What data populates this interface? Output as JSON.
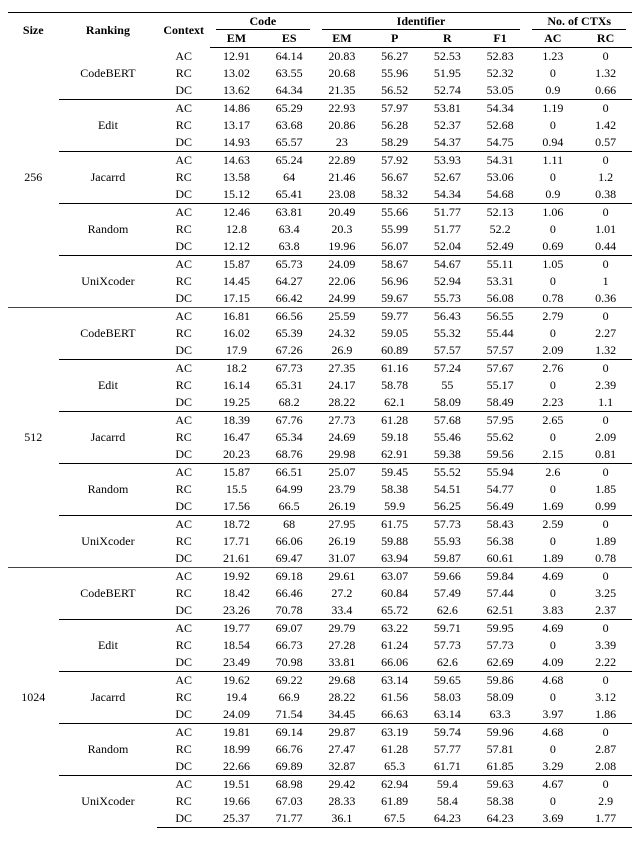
{
  "header": {
    "size": "Size",
    "ranking": "Ranking",
    "context": "Context",
    "code_group": "Code",
    "code_em": "EM",
    "code_es": "ES",
    "ident_group": "Identifier",
    "ident_em": "EM",
    "ident_p": "P",
    "ident_r": "R",
    "ident_f1": "F1",
    "nctx_group": "No. of CTXs",
    "nctx_ac": "AC",
    "nctx_rc": "RC"
  },
  "sizes": [
    "256",
    "512",
    "1024"
  ],
  "rankings": [
    "CodeBERT",
    "Edit",
    "Jacarrd",
    "Random",
    "UniXcoder"
  ],
  "contexts": [
    "AC",
    "RC",
    "DC"
  ],
  "chart_data": {
    "type": "table",
    "columns": [
      "Size",
      "Ranking",
      "Context",
      "Code.EM",
      "Code.ES",
      "Identifier.EM",
      "Identifier.P",
      "Identifier.R",
      "Identifier.F1",
      "CTXs.AC",
      "CTXs.RC"
    ]
  },
  "data": {
    "256": {
      "CodeBERT": {
        "AC": {
          "c_em": "12.91",
          "c_es": "64.14",
          "i_em": "20.83",
          "i_p": "56.27",
          "i_r": "52.53",
          "i_f1": "52.83",
          "n_ac": "1.23",
          "n_rc": "0"
        },
        "RC": {
          "c_em": "13.02",
          "c_es": "63.55",
          "i_em": "20.68",
          "i_p": "55.96",
          "i_r": "51.95",
          "i_f1": "52.32",
          "n_ac": "0",
          "n_rc": "1.32"
        },
        "DC": {
          "c_em": "13.62",
          "c_es": "64.34",
          "i_em": "21.35",
          "i_p": "56.52",
          "i_r": "52.74",
          "i_f1": "53.05",
          "n_ac": "0.9",
          "n_rc": "0.66"
        }
      },
      "Edit": {
        "AC": {
          "c_em": "14.86",
          "c_es": "65.29",
          "i_em": "22.93",
          "i_p": "57.97",
          "i_r": "53.81",
          "i_f1": "54.34",
          "n_ac": "1.19",
          "n_rc": "0"
        },
        "RC": {
          "c_em": "13.17",
          "c_es": "63.68",
          "i_em": "20.86",
          "i_p": "56.28",
          "i_r": "52.37",
          "i_f1": "52.68",
          "n_ac": "0",
          "n_rc": "1.42"
        },
        "DC": {
          "c_em": "14.93",
          "c_es": "65.57",
          "i_em": "23",
          "i_p": "58.29",
          "i_r": "54.37",
          "i_f1": "54.75",
          "n_ac": "0.94",
          "n_rc": "0.57"
        }
      },
      "Jacarrd": {
        "AC": {
          "c_em": "14.63",
          "c_es": "65.24",
          "i_em": "22.89",
          "i_p": "57.92",
          "i_r": "53.93",
          "i_f1": "54.31",
          "n_ac": "1.11",
          "n_rc": "0"
        },
        "RC": {
          "c_em": "13.58",
          "c_es": "64",
          "i_em": "21.46",
          "i_p": "56.67",
          "i_r": "52.67",
          "i_f1": "53.06",
          "n_ac": "0",
          "n_rc": "1.2"
        },
        "DC": {
          "c_em": "15.12",
          "c_es": "65.41",
          "i_em": "23.08",
          "i_p": "58.32",
          "i_r": "54.34",
          "i_f1": "54.68",
          "n_ac": "0.9",
          "n_rc": "0.38"
        }
      },
      "Random": {
        "AC": {
          "c_em": "12.46",
          "c_es": "63.81",
          "i_em": "20.49",
          "i_p": "55.66",
          "i_r": "51.77",
          "i_f1": "52.13",
          "n_ac": "1.06",
          "n_rc": "0"
        },
        "RC": {
          "c_em": "12.8",
          "c_es": "63.4",
          "i_em": "20.3",
          "i_p": "55.99",
          "i_r": "51.77",
          "i_f1": "52.2",
          "n_ac": "0",
          "n_rc": "1.01"
        },
        "DC": {
          "c_em": "12.12",
          "c_es": "63.8",
          "i_em": "19.96",
          "i_p": "56.07",
          "i_r": "52.04",
          "i_f1": "52.49",
          "n_ac": "0.69",
          "n_rc": "0.44"
        }
      },
      "UniXcoder": {
        "AC": {
          "c_em": "15.87",
          "c_es": "65.73",
          "i_em": "24.09",
          "i_p": "58.67",
          "i_r": "54.67",
          "i_f1": "55.11",
          "n_ac": "1.05",
          "n_rc": "0"
        },
        "RC": {
          "c_em": "14.45",
          "c_es": "64.27",
          "i_em": "22.06",
          "i_p": "56.96",
          "i_r": "52.94",
          "i_f1": "53.31",
          "n_ac": "0",
          "n_rc": "1"
        },
        "DC": {
          "c_em": "17.15",
          "c_es": "66.42",
          "i_em": "24.99",
          "i_p": "59.67",
          "i_r": "55.73",
          "i_f1": "56.08",
          "n_ac": "0.78",
          "n_rc": "0.36"
        }
      }
    },
    "512": {
      "CodeBERT": {
        "AC": {
          "c_em": "16.81",
          "c_es": "66.56",
          "i_em": "25.59",
          "i_p": "59.77",
          "i_r": "56.43",
          "i_f1": "56.55",
          "n_ac": "2.79",
          "n_rc": "0"
        },
        "RC": {
          "c_em": "16.02",
          "c_es": "65.39",
          "i_em": "24.32",
          "i_p": "59.05",
          "i_r": "55.32",
          "i_f1": "55.44",
          "n_ac": "0",
          "n_rc": "2.27"
        },
        "DC": {
          "c_em": "17.9",
          "c_es": "67.26",
          "i_em": "26.9",
          "i_p": "60.89",
          "i_r": "57.57",
          "i_f1": "57.57",
          "n_ac": "2.09",
          "n_rc": "1.32"
        }
      },
      "Edit": {
        "AC": {
          "c_em": "18.2",
          "c_es": "67.73",
          "i_em": "27.35",
          "i_p": "61.16",
          "i_r": "57.24",
          "i_f1": "57.67",
          "n_ac": "2.76",
          "n_rc": "0"
        },
        "RC": {
          "c_em": "16.14",
          "c_es": "65.31",
          "i_em": "24.17",
          "i_p": "58.78",
          "i_r": "55",
          "i_f1": "55.17",
          "n_ac": "0",
          "n_rc": "2.39"
        },
        "DC": {
          "c_em": "19.25",
          "c_es": "68.2",
          "i_em": "28.22",
          "i_p": "62.1",
          "i_r": "58.09",
          "i_f1": "58.49",
          "n_ac": "2.23",
          "n_rc": "1.1"
        }
      },
      "Jacarrd": {
        "AC": {
          "c_em": "18.39",
          "c_es": "67.76",
          "i_em": "27.73",
          "i_p": "61.28",
          "i_r": "57.68",
          "i_f1": "57.95",
          "n_ac": "2.65",
          "n_rc": "0"
        },
        "RC": {
          "c_em": "16.47",
          "c_es": "65.34",
          "i_em": "24.69",
          "i_p": "59.18",
          "i_r": "55.46",
          "i_f1": "55.62",
          "n_ac": "0",
          "n_rc": "2.09"
        },
        "DC": {
          "c_em": "20.23",
          "c_es": "68.76",
          "i_em": "29.98",
          "i_p": "62.91",
          "i_r": "59.38",
          "i_f1": "59.56",
          "n_ac": "2.15",
          "n_rc": "0.81"
        }
      },
      "Random": {
        "AC": {
          "c_em": "15.87",
          "c_es": "66.51",
          "i_em": "25.07",
          "i_p": "59.45",
          "i_r": "55.52",
          "i_f1": "55.94",
          "n_ac": "2.6",
          "n_rc": "0"
        },
        "RC": {
          "c_em": "15.5",
          "c_es": "64.99",
          "i_em": "23.79",
          "i_p": "58.38",
          "i_r": "54.51",
          "i_f1": "54.77",
          "n_ac": "0",
          "n_rc": "1.85"
        },
        "DC": {
          "c_em": "17.56",
          "c_es": "66.5",
          "i_em": "26.19",
          "i_p": "59.9",
          "i_r": "56.25",
          "i_f1": "56.49",
          "n_ac": "1.69",
          "n_rc": "0.99"
        }
      },
      "UniXcoder": {
        "AC": {
          "c_em": "18.72",
          "c_es": "68",
          "i_em": "27.95",
          "i_p": "61.75",
          "i_r": "57.73",
          "i_f1": "58.43",
          "n_ac": "2.59",
          "n_rc": "0"
        },
        "RC": {
          "c_em": "17.71",
          "c_es": "66.06",
          "i_em": "26.19",
          "i_p": "59.88",
          "i_r": "55.93",
          "i_f1": "56.38",
          "n_ac": "0",
          "n_rc": "1.89"
        },
        "DC": {
          "c_em": "21.61",
          "c_es": "69.47",
          "i_em": "31.07",
          "i_p": "63.94",
          "i_r": "59.87",
          "i_f1": "60.61",
          "n_ac": "1.89",
          "n_rc": "0.78"
        }
      }
    },
    "1024": {
      "CodeBERT": {
        "AC": {
          "c_em": "19.92",
          "c_es": "69.18",
          "i_em": "29.61",
          "i_p": "63.07",
          "i_r": "59.66",
          "i_f1": "59.84",
          "n_ac": "4.69",
          "n_rc": "0"
        },
        "RC": {
          "c_em": "18.42",
          "c_es": "66.46",
          "i_em": "27.2",
          "i_p": "60.84",
          "i_r": "57.49",
          "i_f1": "57.44",
          "n_ac": "0",
          "n_rc": "3.25"
        },
        "DC": {
          "c_em": "23.26",
          "c_es": "70.78",
          "i_em": "33.4",
          "i_p": "65.72",
          "i_r": "62.6",
          "i_f1": "62.51",
          "n_ac": "3.83",
          "n_rc": "2.37"
        }
      },
      "Edit": {
        "AC": {
          "c_em": "19.77",
          "c_es": "69.07",
          "i_em": "29.79",
          "i_p": "63.22",
          "i_r": "59.71",
          "i_f1": "59.95",
          "n_ac": "4.69",
          "n_rc": "0"
        },
        "RC": {
          "c_em": "18.54",
          "c_es": "66.73",
          "i_em": "27.28",
          "i_p": "61.24",
          "i_r": "57.73",
          "i_f1": "57.73",
          "n_ac": "0",
          "n_rc": "3.39"
        },
        "DC": {
          "c_em": "23.49",
          "c_es": "70.98",
          "i_em": "33.81",
          "i_p": "66.06",
          "i_r": "62.6",
          "i_f1": "62.69",
          "n_ac": "4.09",
          "n_rc": "2.22"
        }
      },
      "Jacarrd": {
        "AC": {
          "c_em": "19.62",
          "c_es": "69.22",
          "i_em": "29.68",
          "i_p": "63.14",
          "i_r": "59.65",
          "i_f1": "59.86",
          "n_ac": "4.68",
          "n_rc": "0"
        },
        "RC": {
          "c_em": "19.4",
          "c_es": "66.9",
          "i_em": "28.22",
          "i_p": "61.56",
          "i_r": "58.03",
          "i_f1": "58.09",
          "n_ac": "0",
          "n_rc": "3.12"
        },
        "DC": {
          "c_em": "24.09",
          "c_es": "71.54",
          "i_em": "34.45",
          "i_p": "66.63",
          "i_r": "63.14",
          "i_f1": "63.3",
          "n_ac": "3.97",
          "n_rc": "1.86"
        }
      },
      "Random": {
        "AC": {
          "c_em": "19.81",
          "c_es": "69.14",
          "i_em": "29.87",
          "i_p": "63.19",
          "i_r": "59.74",
          "i_f1": "59.96",
          "n_ac": "4.68",
          "n_rc": "0"
        },
        "RC": {
          "c_em": "18.99",
          "c_es": "66.76",
          "i_em": "27.47",
          "i_p": "61.28",
          "i_r": "57.77",
          "i_f1": "57.81",
          "n_ac": "0",
          "n_rc": "2.87"
        },
        "DC": {
          "c_em": "22.66",
          "c_es": "69.89",
          "i_em": "32.87",
          "i_p": "65.3",
          "i_r": "61.71",
          "i_f1": "61.85",
          "n_ac": "3.29",
          "n_rc": "2.08"
        }
      },
      "UniXcoder": {
        "AC": {
          "c_em": "19.51",
          "c_es": "68.98",
          "i_em": "29.42",
          "i_p": "62.94",
          "i_r": "59.4",
          "i_f1": "59.63",
          "n_ac": "4.67",
          "n_rc": "0"
        },
        "RC": {
          "c_em": "19.66",
          "c_es": "67.03",
          "i_em": "28.33",
          "i_p": "61.89",
          "i_r": "58.4",
          "i_f1": "58.38",
          "n_ac": "0",
          "n_rc": "2.9"
        },
        "DC": {
          "c_em": "25.37",
          "c_es": "71.77",
          "i_em": "36.1",
          "i_p": "67.5",
          "i_r": "64.23",
          "i_f1": "64.23",
          "n_ac": "3.69",
          "n_rc": "1.77"
        }
      }
    }
  }
}
